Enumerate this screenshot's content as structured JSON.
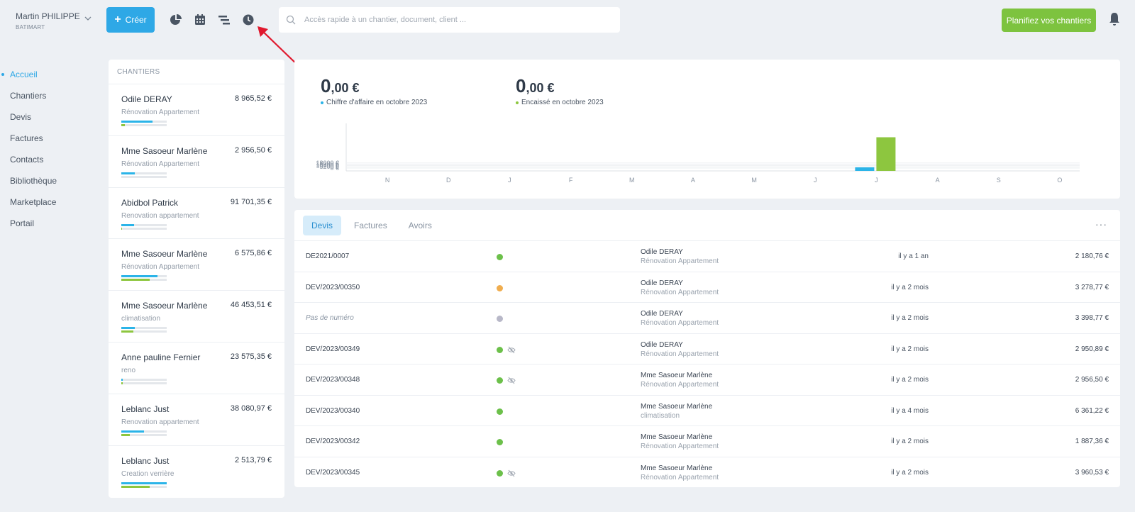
{
  "user": {
    "name": "Martin PHILIPPE",
    "company": "BATIMART"
  },
  "toolbar": {
    "create_label": "Créer",
    "search_placeholder": "Accès rapide à un chantier, document, client ...",
    "plan_label": "Planifiez vos chantiers",
    "icons": [
      "pie-chart-icon",
      "calendar-icon",
      "gantt-icon",
      "clock-icon",
      "bell-icon"
    ]
  },
  "colors": {
    "accent": "#2ea8e6",
    "green": "#7dc33f",
    "orange": "#f0ad4e",
    "grey": "#b8b8c8",
    "annotation": "#e0182d"
  },
  "sidebar": {
    "items": [
      {
        "label": "Accueil",
        "active": true
      },
      {
        "label": "Chantiers"
      },
      {
        "label": "Devis"
      },
      {
        "label": "Factures"
      },
      {
        "label": "Contacts"
      },
      {
        "label": "Bibliothèque"
      },
      {
        "label": "Marketplace"
      },
      {
        "label": "Portail"
      }
    ]
  },
  "chantiers": {
    "title": "CHANTIERS",
    "items": [
      {
        "name": "Odile DERAY",
        "amount": "8 965,52 €",
        "subtitle": "Rénovation Appartement",
        "progress_blue": 0.68,
        "progress_green": 0.08
      },
      {
        "name": "Mme Sasoeur Marlène",
        "amount": "2 956,50 €",
        "subtitle": "Rénovation Appartement",
        "progress_blue": 0.3,
        "progress_green": 0.0
      },
      {
        "name": "Abidbol Patrick",
        "amount": "91 701,35 €",
        "subtitle": "Renovation appartement",
        "progress_blue": 0.28,
        "progress_green": 0.02
      },
      {
        "name": "Mme Sasoeur Marlène",
        "amount": "6 575,86 €",
        "subtitle": "Rénovation Appartement",
        "progress_blue": 0.8,
        "progress_green": 0.62
      },
      {
        "name": "Mme Sasoeur Marlène",
        "amount": "46 453,51 €",
        "subtitle": "climatisation",
        "progress_blue": 0.3,
        "progress_green": 0.26
      },
      {
        "name": "Anne pauline Fernier",
        "amount": "23 575,35 €",
        "subtitle": "reno",
        "progress_blue": 0.03,
        "progress_green": 0.03
      },
      {
        "name": "Leblanc Just",
        "amount": "38 080,97 €",
        "subtitle": "Renovation appartement",
        "progress_blue": 0.5,
        "progress_green": 0.18
      },
      {
        "name": "Leblanc Just",
        "amount": "2 513,79 €",
        "subtitle": "Creation verrière",
        "progress_blue": 1.0,
        "progress_green": 0.63
      }
    ]
  },
  "stats": {
    "revenue": {
      "int": "0",
      "dec": ",00 €",
      "label": "Chiffre d'affaire en octobre 2023"
    },
    "collected": {
      "int": "0",
      "dec": ",00 €",
      "label": "Encaissé en octobre 2023"
    }
  },
  "chart_data": {
    "type": "bar",
    "categories": [
      "N",
      "D",
      "J",
      "F",
      "M",
      "A",
      "M",
      "J",
      "J",
      "A",
      "S",
      "O"
    ],
    "series": [
      {
        "values": [
          0,
          0,
          0,
          0,
          0,
          0,
          0,
          0,
          1800,
          0,
          0,
          0
        ]
      },
      {
        "values": [
          0,
          0,
          0,
          0,
          0,
          0,
          0,
          0,
          17000,
          0,
          0,
          0
        ]
      }
    ],
    "series_colors": [
      "#2bb4e8",
      "#8dc63f"
    ],
    "y_tick_labels": [
      "0 €",
      "5200 €",
      "10400 €",
      "15600 €",
      "18000 €"
    ],
    "ylim": [
      0,
      18000
    ],
    "grid": true
  },
  "documents": {
    "tabs": [
      {
        "label": "Devis",
        "active": true
      },
      {
        "label": "Factures"
      },
      {
        "label": "Avoirs"
      }
    ],
    "more_label": "···",
    "rows": [
      {
        "number": "DE2021/0007",
        "status": "green",
        "viewed": false,
        "client": "Odile DERAY",
        "project": "Rénovation Appartement",
        "date": "il y a 1 an",
        "amount": "2 180,76 €"
      },
      {
        "number": "DEV/2023/00350",
        "status": "orange",
        "viewed": false,
        "client": "Odile DERAY",
        "project": "Rénovation Appartement",
        "date": "il y a 2 mois",
        "amount": "3 278,77 €"
      },
      {
        "number": "Pas de numéro",
        "status": "grey",
        "viewed": false,
        "empty": true,
        "client": "Odile DERAY",
        "project": "Rénovation Appartement",
        "date": "il y a 2 mois",
        "amount": "3 398,77 €"
      },
      {
        "number": "DEV/2023/00349",
        "status": "green",
        "viewed": true,
        "client": "Odile DERAY",
        "project": "Rénovation Appartement",
        "date": "il y a 2 mois",
        "amount": "2 950,89 €"
      },
      {
        "number": "DEV/2023/00348",
        "status": "green",
        "viewed": true,
        "client": "Mme Sasoeur Marlène",
        "project": "Rénovation Appartement",
        "date": "il y a 2 mois",
        "amount": "2 956,50 €"
      },
      {
        "number": "DEV/2023/00340",
        "status": "green",
        "viewed": false,
        "client": "Mme Sasoeur Marlène",
        "project": "climatisation",
        "date": "il y a 4 mois",
        "amount": "6 361,22 €"
      },
      {
        "number": "DEV/2023/00342",
        "status": "green",
        "viewed": false,
        "client": "Mme Sasoeur Marlène",
        "project": "Rénovation Appartement",
        "date": "il y a 2 mois",
        "amount": "1 887,36 €"
      },
      {
        "number": "DEV/2023/00345",
        "status": "green",
        "viewed": true,
        "client": "Mme Sasoeur Marlène",
        "project": "Rénovation Appartement",
        "date": "il y a 2 mois",
        "amount": "3 960,53 €"
      }
    ]
  }
}
